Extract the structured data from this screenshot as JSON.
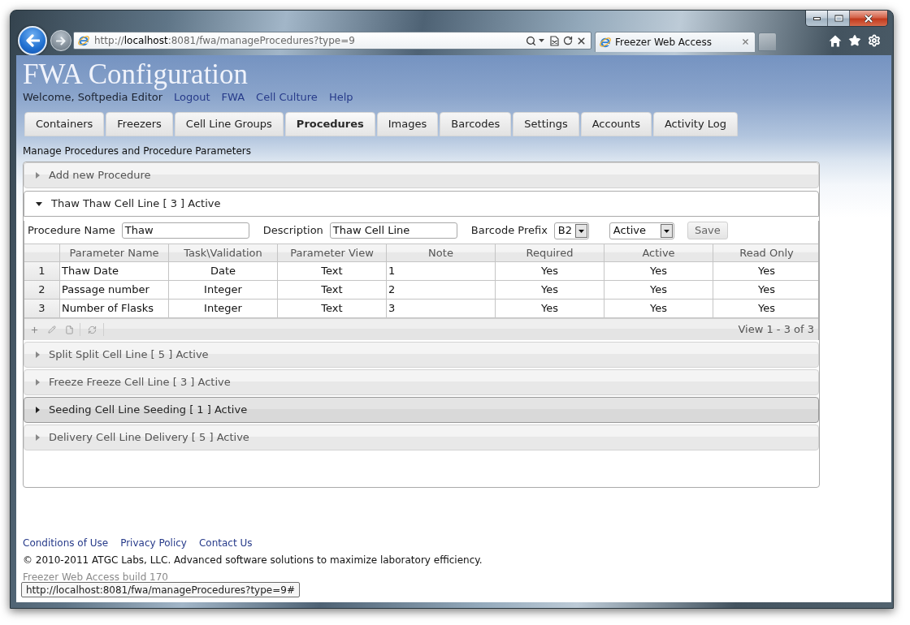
{
  "browser": {
    "address": "http://**localhost**:8081/fwa/manageProcedures?type=9",
    "tab_title": "Freezer Web Access",
    "status_url": "http://localhost:8081/fwa/manageProcedures?type=9#"
  },
  "header": {
    "title": "FWA Configuration",
    "welcome": "Welcome, Softpedia Editor",
    "links": [
      "Logout",
      "FWA",
      "Cell Culture",
      "Help"
    ]
  },
  "tabs": [
    {
      "label": "Containers",
      "selected": false
    },
    {
      "label": "Freezers",
      "selected": false
    },
    {
      "label": "Cell Line Groups",
      "selected": false
    },
    {
      "label": "Procedures",
      "selected": true
    },
    {
      "label": "Images",
      "selected": false
    },
    {
      "label": "Barcodes",
      "selected": false
    },
    {
      "label": "Settings",
      "selected": false
    },
    {
      "label": "Accounts",
      "selected": false
    },
    {
      "label": "Activity Log",
      "selected": false
    }
  ],
  "subtitle": "Manage Procedures and Procedure Parameters",
  "procedures": [
    {
      "label": "Add new Procedure",
      "expanded": false,
      "highlighted": false
    },
    {
      "label": "Thaw Thaw Cell Line [ 3 ] Active",
      "expanded": true,
      "highlighted": false,
      "form": {
        "fields": [
          {
            "kind": "text",
            "label": "Procedure Name",
            "value": "Thaw"
          },
          {
            "kind": "text",
            "label": "Description",
            "value": "Thaw Cell Line"
          },
          {
            "kind": "select",
            "label": "Barcode Prefix",
            "value": "B2"
          },
          {
            "kind": "select",
            "value": "Active"
          }
        ],
        "save_button": "Save"
      },
      "grid": {
        "columns": [
          "Parameter Name",
          "Task\\Validation",
          "Parameter View",
          "Note",
          "Required",
          "Active",
          "Read Only"
        ],
        "rows": [
          {
            "number": "1",
            "cells": [
              "Thaw Date",
              "Date",
              "Text",
              "1",
              "Yes",
              "Yes",
              "Yes"
            ]
          },
          {
            "number": "2",
            "cells": [
              "Passage number",
              "Integer",
              "Text",
              "2",
              "Yes",
              "Yes",
              "Yes"
            ]
          },
          {
            "number": "3",
            "cells": [
              "Number of Flasks",
              "Integer",
              "Text",
              "3",
              "Yes",
              "Yes",
              "Yes"
            ]
          }
        ],
        "pager": "View 1 - 3 of 3"
      }
    },
    {
      "label": "Split Split Cell Line [ 5 ] Active",
      "expanded": false,
      "highlighted": false
    },
    {
      "label": "Freeze Freeze Cell Line [ 3 ] Active",
      "expanded": false,
      "highlighted": false
    },
    {
      "label": "Seeding Cell Line Seeding [ 1 ] Active",
      "expanded": false,
      "highlighted": true
    },
    {
      "label": "Delivery Cell Line Delivery [ 5 ] Active",
      "expanded": false,
      "highlighted": false
    }
  ],
  "footer": {
    "links": [
      "Conditions of Use",
      "Privacy Policy",
      "Contact Us"
    ],
    "copyright": "© 2010-2011 ATGC Labs, LLC. Advanced software solutions to maximize laboratory efficiency.",
    "build": "Freezer Web Access build 170"
  }
}
